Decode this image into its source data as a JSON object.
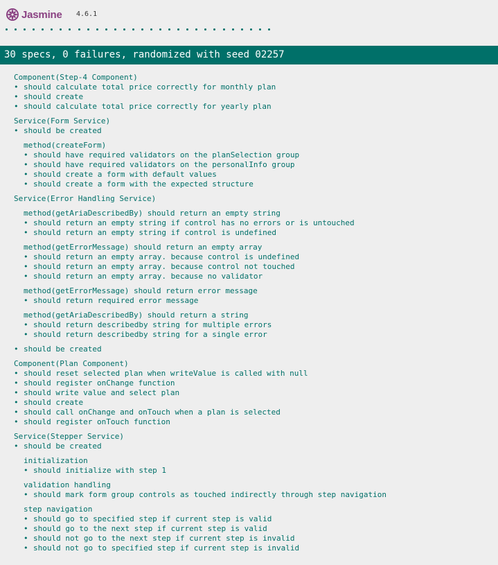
{
  "app": {
    "name": "Jasmine",
    "version": "4.6.1",
    "dot_count": 30
  },
  "summary": "30 specs, 0 failures, randomized with seed 02257",
  "colors": {
    "brand": "#8a4182",
    "pass": "#007069",
    "background": "#eeeeee"
  },
  "icons": {
    "logo": "jasmine-flower-icon"
  },
  "results": [
    {
      "kind": "suite",
      "text": "Component(Step-4 Component)"
    },
    {
      "kind": "spec",
      "text": "should calculate total price correctly for monthly plan"
    },
    {
      "kind": "spec",
      "text": "should create"
    },
    {
      "kind": "spec",
      "text": "should calculate total price correctly for yearly plan"
    },
    {
      "kind": "suite",
      "text": "Service(Form Service)"
    },
    {
      "kind": "spec",
      "text": "should be created"
    },
    {
      "kind": "suite",
      "text": "method(createForm)"
    },
    {
      "kind": "spec",
      "text": "should have required validators on the planSelection group"
    },
    {
      "kind": "spec",
      "text": "should have required validators on the personalInfo group"
    },
    {
      "kind": "spec",
      "text": "should create a form with default values"
    },
    {
      "kind": "spec",
      "text": "should create a form with the expected structure"
    },
    {
      "kind": "suite",
      "text": "Service(Error Handling Service)"
    },
    {
      "kind": "suite",
      "text": "method(getAriaDescribedBy) should return an empty string"
    },
    {
      "kind": "spec",
      "text": "should return an empty string if control has no errors or is untouched"
    },
    {
      "kind": "spec",
      "text": "should return an empty string if control is undefined"
    },
    {
      "kind": "suite",
      "text": "method(getErrorMessage) should return an empty array"
    },
    {
      "kind": "spec",
      "text": "should return an empty array. because control is undefined"
    },
    {
      "kind": "spec",
      "text": "should return an empty array. because control not touched"
    },
    {
      "kind": "spec",
      "text": "should return an empty array. because no validator"
    },
    {
      "kind": "suite",
      "text": "method(getErrorMessage) should return error message"
    },
    {
      "kind": "spec",
      "text": "should return required error message"
    },
    {
      "kind": "suite",
      "text": "method(getAriaDescribedBy) should return a string"
    },
    {
      "kind": "spec",
      "text": "should return describedby string for multiple errors"
    },
    {
      "kind": "spec",
      "text": "should return describedby string for a single error"
    },
    {
      "kind": "spec",
      "text": "should be created"
    },
    {
      "kind": "suite",
      "text": "Component(Plan Component)"
    },
    {
      "kind": "spec",
      "text": "should reset selected plan when writeValue is called with null"
    },
    {
      "kind": "spec",
      "text": "should register onChange function"
    },
    {
      "kind": "spec",
      "text": "should write value and select plan"
    },
    {
      "kind": "spec",
      "text": "should create"
    },
    {
      "kind": "spec",
      "text": "should call onChange and onTouch when a plan is selected"
    },
    {
      "kind": "spec",
      "text": "should register onTouch function"
    },
    {
      "kind": "suite",
      "text": "Service(Stepper Service)"
    },
    {
      "kind": "spec",
      "text": "should be created"
    },
    {
      "kind": "suite",
      "text": "initialization"
    },
    {
      "kind": "spec",
      "text": "should initialize with step 1"
    },
    {
      "kind": "suite",
      "text": "validation handling"
    },
    {
      "kind": "spec",
      "text": "should mark form group controls as touched indirectly through step navigation"
    },
    {
      "kind": "suite",
      "text": "step navigation"
    },
    {
      "kind": "spec",
      "text": "should go to specified step if current step is valid"
    },
    {
      "kind": "spec",
      "text": "should go to the next step if current step is valid"
    },
    {
      "kind": "spec",
      "text": "should not go to the next step if current step is invalid"
    },
    {
      "kind": "spec",
      "text": "should not go to specified step if current step is invalid"
    }
  ]
}
